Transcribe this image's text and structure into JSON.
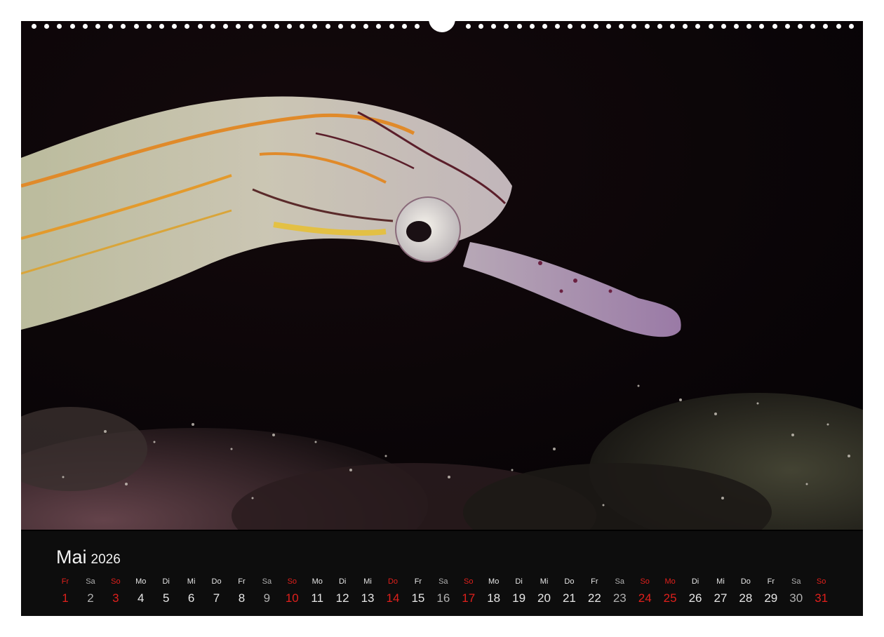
{
  "calendar": {
    "month": "Mai",
    "year": "2026",
    "days": [
      {
        "wd": "Fr",
        "d": "1",
        "red": true
      },
      {
        "wd": "Sa",
        "d": "2",
        "sat": true
      },
      {
        "wd": "So",
        "d": "3",
        "red": true
      },
      {
        "wd": "Mo",
        "d": "4"
      },
      {
        "wd": "Di",
        "d": "5"
      },
      {
        "wd": "Mi",
        "d": "6"
      },
      {
        "wd": "Do",
        "d": "7"
      },
      {
        "wd": "Fr",
        "d": "8"
      },
      {
        "wd": "Sa",
        "d": "9",
        "sat": true
      },
      {
        "wd": "So",
        "d": "10",
        "red": true
      },
      {
        "wd": "Mo",
        "d": "11"
      },
      {
        "wd": "Di",
        "d": "12"
      },
      {
        "wd": "Mi",
        "d": "13"
      },
      {
        "wd": "Do",
        "d": "14",
        "red": true
      },
      {
        "wd": "Fr",
        "d": "15"
      },
      {
        "wd": "Sa",
        "d": "16",
        "sat": true
      },
      {
        "wd": "So",
        "d": "17",
        "red": true
      },
      {
        "wd": "Mo",
        "d": "18"
      },
      {
        "wd": "Di",
        "d": "19"
      },
      {
        "wd": "Mi",
        "d": "20"
      },
      {
        "wd": "Do",
        "d": "21"
      },
      {
        "wd": "Fr",
        "d": "22"
      },
      {
        "wd": "Sa",
        "d": "23",
        "sat": true
      },
      {
        "wd": "So",
        "d": "24",
        "red": true
      },
      {
        "wd": "Mo",
        "d": "25",
        "red": true
      },
      {
        "wd": "Di",
        "d": "26"
      },
      {
        "wd": "Mi",
        "d": "27"
      },
      {
        "wd": "Do",
        "d": "28"
      },
      {
        "wd": "Fr",
        "d": "29"
      },
      {
        "wd": "Sa",
        "d": "30",
        "sat": true
      },
      {
        "wd": "So",
        "d": "31",
        "red": true
      }
    ]
  },
  "colors": {
    "holiday": "#e0201c",
    "background": "#000000",
    "calendar_bar": "#0d0d0d"
  }
}
